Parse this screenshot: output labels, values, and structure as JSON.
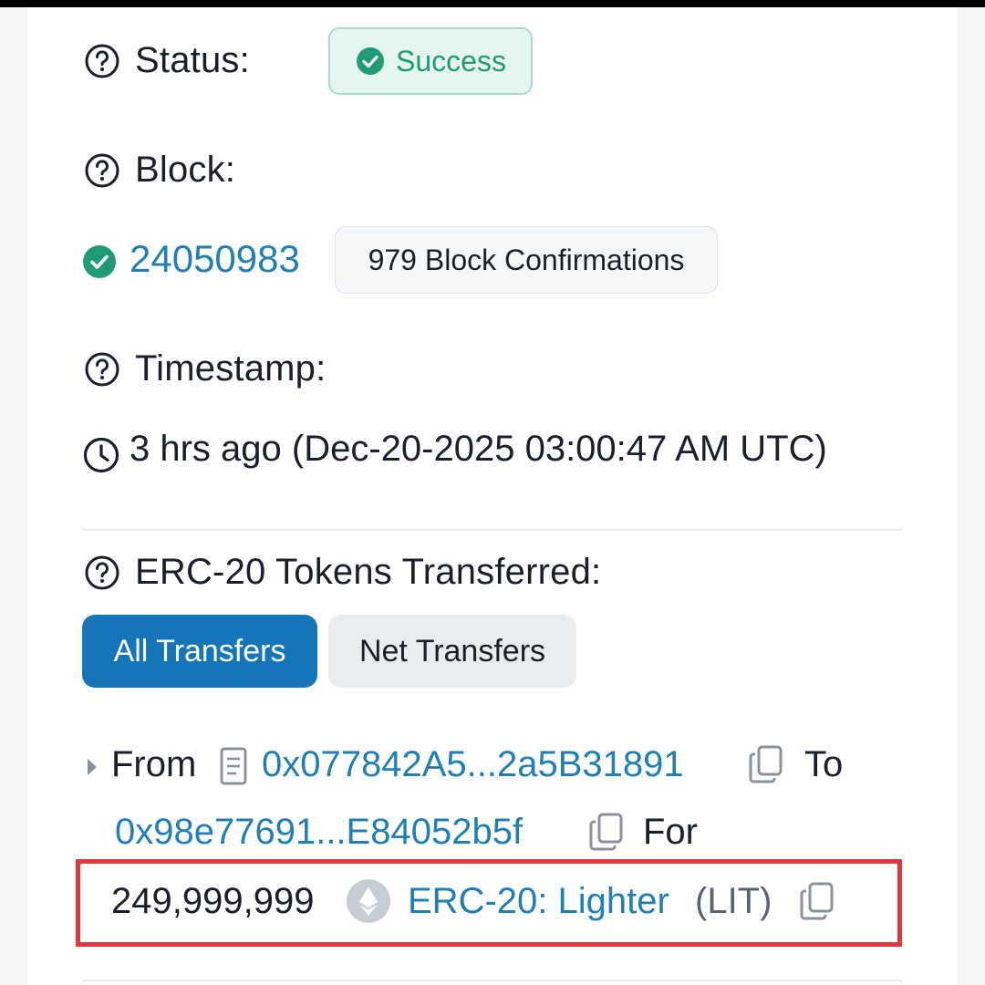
{
  "status": {
    "label": "Status:",
    "value": "Success"
  },
  "block": {
    "label": "Block:",
    "number": "24050983",
    "confirmations": "979 Block Confirmations"
  },
  "timestamp": {
    "label": "Timestamp:",
    "value": "3 hrs ago (Dec-20-2025 03:00:47 AM UTC)"
  },
  "tokens": {
    "label": "ERC-20 Tokens Transferred:",
    "tabs": [
      {
        "label": "All Transfers",
        "active": true
      },
      {
        "label": "Net Transfers",
        "active": false
      }
    ],
    "transfer": {
      "from_label": "From",
      "from_address": "0x077842A5...2a5B31891",
      "to_label": "To",
      "to_address": "0x98e77691...E84052b5f",
      "for_label": "For",
      "amount": "249,999,999",
      "token_name": "ERC-20: Lighter",
      "token_symbol": "(LIT)"
    }
  },
  "colors": {
    "link": "#1f7fb6",
    "success": "#1f9b77",
    "tab_active": "#1575b8",
    "highlight_border": "#e0383c"
  },
  "icons": [
    "help-circle-icon",
    "check-circle-icon",
    "clock-icon",
    "document-icon",
    "copy-icon",
    "ethereum-icon",
    "caret-right-icon"
  ]
}
